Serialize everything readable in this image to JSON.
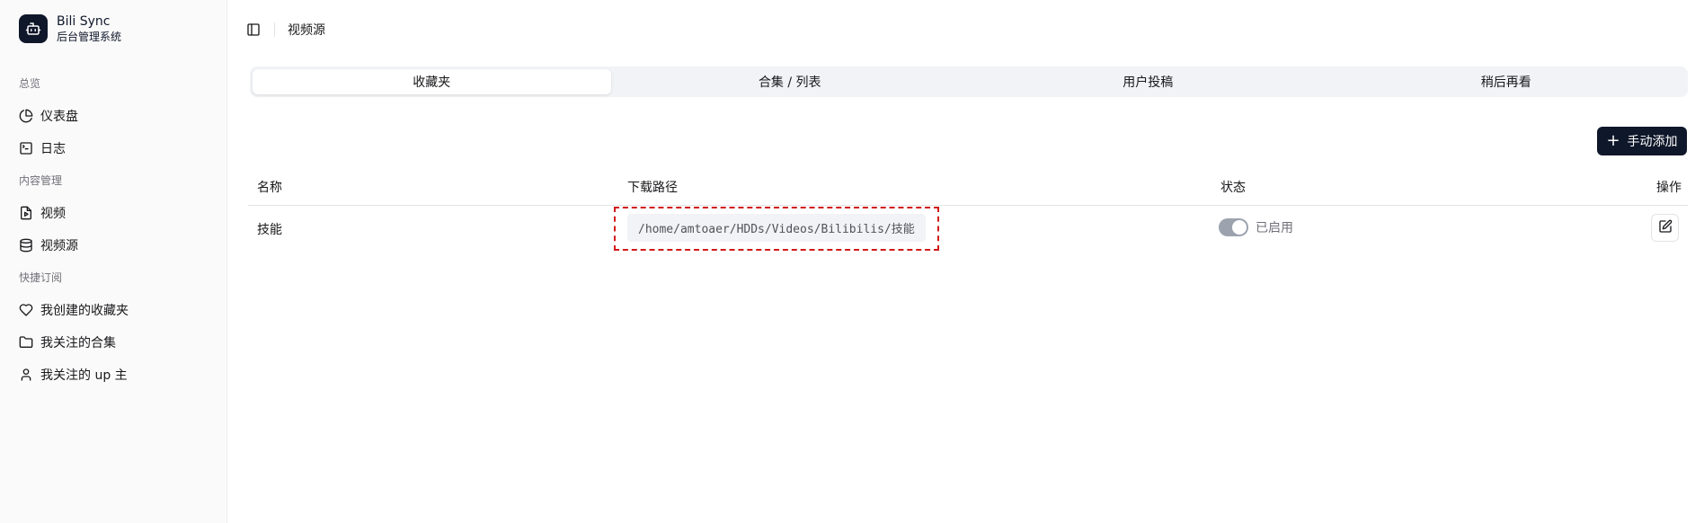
{
  "brand": {
    "title": "Bili Sync",
    "subtitle": "后台管理系统",
    "logo_icon": "robot-icon"
  },
  "sidebar": {
    "groups": [
      {
        "label": "总览",
        "items": [
          {
            "label": "仪表盘",
            "icon": "pie-chart-icon"
          },
          {
            "label": "日志",
            "icon": "terminal-icon"
          }
        ]
      },
      {
        "label": "内容管理",
        "items": [
          {
            "label": "视频",
            "icon": "video-file-icon"
          },
          {
            "label": "视频源",
            "icon": "database-icon"
          }
        ]
      },
      {
        "label": "快捷订阅",
        "items": [
          {
            "label": "我创建的收藏夹",
            "icon": "heart-icon"
          },
          {
            "label": "我关注的合集",
            "icon": "folder-icon"
          },
          {
            "label": "我关注的 up 主",
            "icon": "user-icon"
          }
        ]
      }
    ]
  },
  "header": {
    "breadcrumb": "视频源",
    "toggle_icon": "sidebar-toggle-icon"
  },
  "tabs": [
    {
      "label": "收藏夹",
      "active": true
    },
    {
      "label": "合集 / 列表",
      "active": false
    },
    {
      "label": "用户投稿",
      "active": false
    },
    {
      "label": "稍后再看",
      "active": false
    }
  ],
  "actions": {
    "add_label": "手动添加"
  },
  "table": {
    "columns": [
      "名称",
      "下载路径",
      "状态",
      "操作"
    ],
    "rows": [
      {
        "name": "技能",
        "path": "/home/amtoaer/HDDs/Videos/Bilibilis/技能",
        "enabled": true,
        "status_label": "已启用"
      }
    ]
  },
  "colors": {
    "primary": "#0f172a",
    "highlight_border": "#d11a1a",
    "switch_on": "#9ca3af"
  }
}
